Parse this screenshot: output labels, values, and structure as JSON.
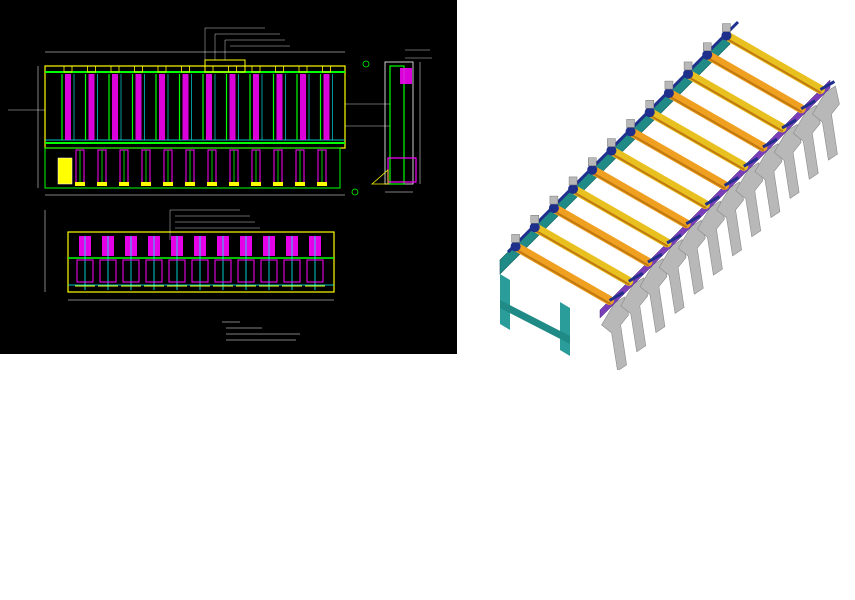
{
  "drawing": {
    "colors": {
      "background": "#000000",
      "frame_yellow": "#ffff00",
      "structure_green": "#00ff00",
      "roller_magenta": "#ff00ff",
      "line_cyan": "#00ffff",
      "blue": "#3355ff",
      "white": "#ffffff",
      "iso_cyan": "#2a9d9a",
      "iso_teal": "#1f8a86",
      "iso_orange": "#f0a020",
      "iso_yellow": "#e8c020",
      "iso_gray": "#b8b8b8",
      "iso_purple": "#7a3fb8",
      "iso_navy": "#1e2f8c"
    },
    "top_view": {
      "roller_count": 12,
      "leg_count": 12
    },
    "side_view": {
      "roller_count": 11
    },
    "iso_view": {
      "roller_count": 12,
      "support_count": 12
    }
  }
}
